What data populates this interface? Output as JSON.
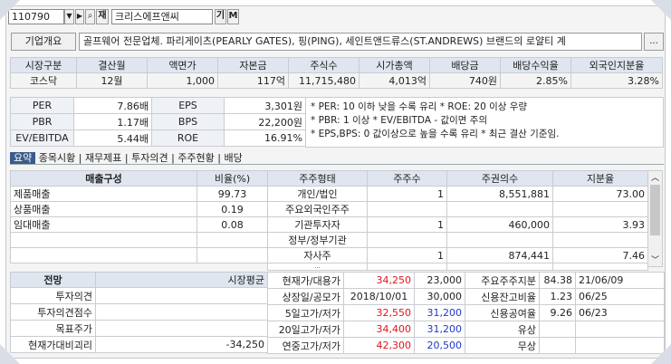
{
  "toolbar": {
    "code": "110790",
    "name": "크리스에프앤씨",
    "btn_ja": "재",
    "btn_gi": "기",
    "btn_m": "M"
  },
  "company": {
    "btn": "기업개요",
    "desc": "골프웨어 전문업체. 파리게이츠(PEARLY GATES), 핑(PING), 세인트앤드류스(ST.ANDREWS) 브랜드의 로얄티 계",
    "more": "..."
  },
  "market": {
    "headers": [
      "시장구분",
      "결산월",
      "액면가",
      "자본금",
      "주식수",
      "시가총액",
      "배당금",
      "배당수익율",
      "외국인지분율"
    ],
    "values": [
      "코스닥",
      "12월",
      "1,000",
      "117억",
      "11,715,480",
      "4,013억",
      "740원",
      "2.85%",
      "3.28%"
    ]
  },
  "ratios": [
    {
      "k1": "PER",
      "v1": "7.86배",
      "k2": "EPS",
      "v2": "3,301원"
    },
    {
      "k1": "PBR",
      "v1": "1.17배",
      "k2": "BPS",
      "v2": "22,200원"
    },
    {
      "k1": "EV/EBITDA",
      "v1": "5.44배",
      "k2": "ROE",
      "v2": "16.91%"
    }
  ],
  "notes": [
    "* PER: 10 이하 낮을 수록 유리 * ROE: 20 이상 우량",
    "* PBR: 1 이상 * EV/EBITDA - 값이면 주의",
    "* EPS,BPS: 0 값이상으로 높을 수록 유리 * 최근 결산 기준임."
  ],
  "tabs": {
    "active": "요약",
    "items": [
      "종목시황",
      "재무제표",
      "투자의견",
      "주주현황",
      "배당"
    ]
  },
  "sales": {
    "headers": [
      "매출구성",
      "비율(%)"
    ],
    "rows": [
      [
        "제품매출",
        "99.73"
      ],
      [
        "상품매출",
        "0.19"
      ],
      [
        "임대매출",
        "0.08"
      ]
    ]
  },
  "holders": {
    "headers": [
      "주주형태",
      "주주수",
      "주권의수",
      "지분율"
    ],
    "rows": [
      [
        "개인/법인",
        "1",
        "8,551,881",
        "73.00"
      ],
      [
        "주요외국인주주",
        "",
        "",
        ""
      ],
      [
        "기관투자자",
        "1",
        "460,000",
        "3.93"
      ],
      [
        "정부/정부기관",
        "",
        "",
        ""
      ],
      [
        "자사주",
        "1",
        "874,441",
        "7.46"
      ],
      [
        "...",
        "",
        "",
        ""
      ]
    ]
  },
  "outlook": {
    "header": "전망",
    "header2": "시장평균",
    "rows": [
      [
        "투자의견",
        ""
      ],
      [
        "투자의견점수",
        ""
      ],
      [
        "목표주가",
        ""
      ],
      [
        "현재가대비괴리",
        "-34,250"
      ]
    ]
  },
  "prices": {
    "rows": [
      [
        "현재가/대용가",
        "34,250",
        "23,000",
        "주요주주지분",
        "84.38",
        "21/06/09"
      ],
      [
        "상장일/공모가",
        "2018/10/01",
        "30,000",
        "신용잔고비율",
        "1.23",
        "06/25"
      ],
      [
        "5일고가/저가",
        "32,550",
        "31,200",
        "신용공여율",
        "9.26",
        "06/23"
      ],
      [
        "20일고가/저가",
        "34,400",
        "31,200",
        "유상",
        "",
        ""
      ],
      [
        "연중고가/저가",
        "42,300",
        "20,500",
        "무상",
        "",
        ""
      ]
    ]
  }
}
